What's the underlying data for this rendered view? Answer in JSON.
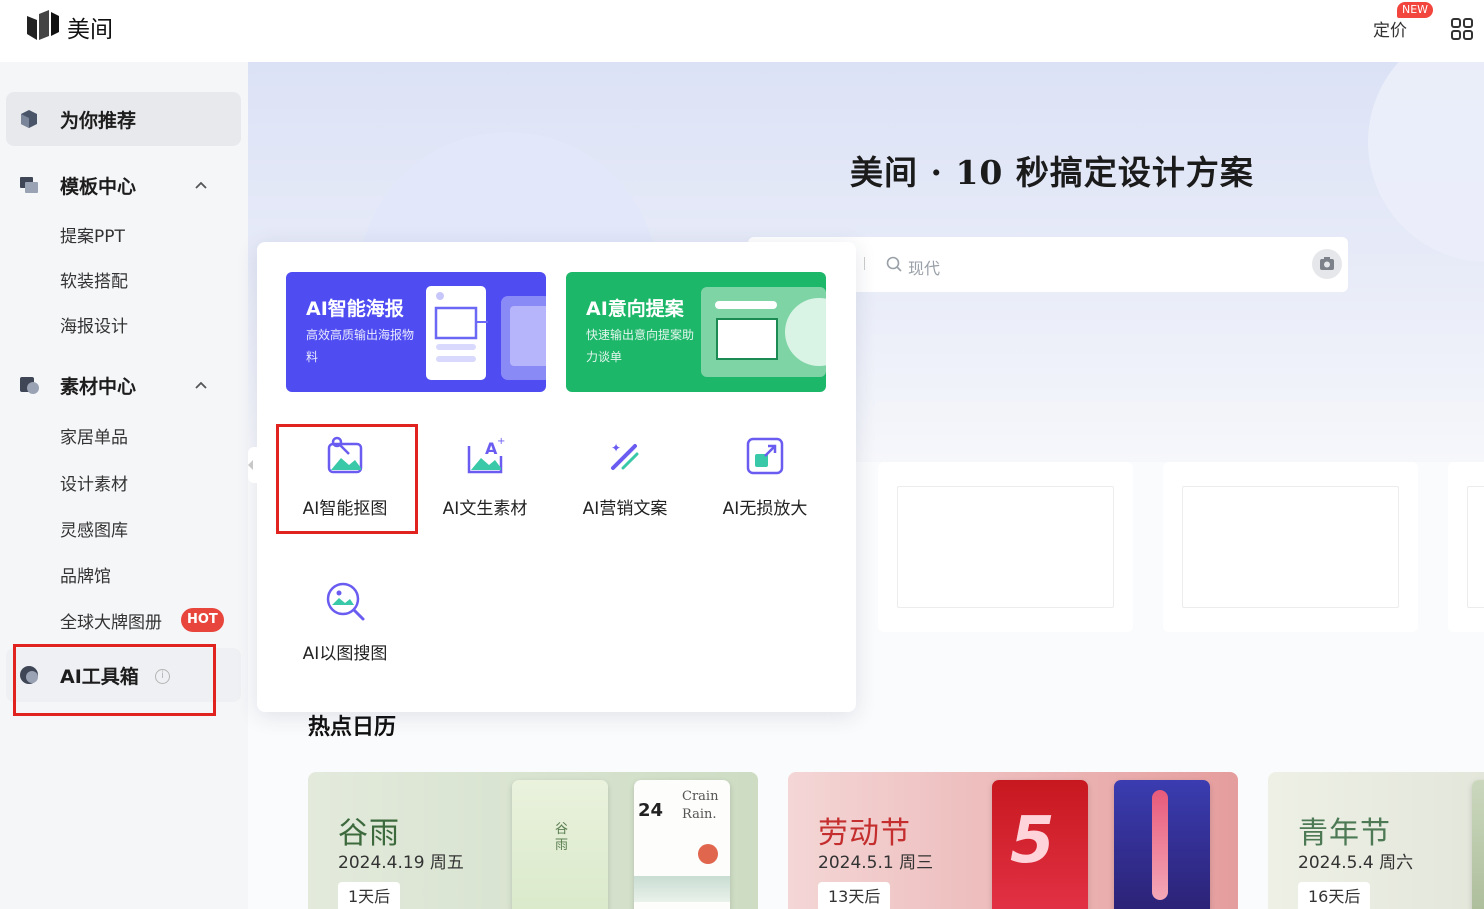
{
  "brand": {
    "name": "美间"
  },
  "header": {
    "pricing_label": "定价",
    "new_badge": "NEW"
  },
  "sidebar": {
    "recommend": "为你推荐",
    "template_center": {
      "label": "模板中心",
      "items": [
        "提案PPT",
        "软装搭配",
        "海报设计"
      ]
    },
    "material_center": {
      "label": "素材中心",
      "items": [
        "家居单品",
        "设计素材",
        "灵感图库",
        "品牌馆",
        "全球大牌图册"
      ],
      "hot_badge": "HOT"
    },
    "ai_toolbox": "AI工具箱"
  },
  "hero": {
    "title": "美间 · 10 秒搞定设计方案",
    "search_placeholder": "现代"
  },
  "ai_popup": {
    "featured": [
      {
        "title": "AI智能海报",
        "desc": "高效高质输出海报物料",
        "color": "#4f4df2"
      },
      {
        "title": "AI意向提案",
        "desc": "快速输出意向提案助力谈单",
        "color": "#1db76a"
      }
    ],
    "tools": [
      "AI智能抠图",
      "AI文生素材",
      "AI营销文案",
      "AI无损放大",
      "AI以图搜图"
    ]
  },
  "calendar": {
    "title": "热点日历",
    "events": [
      {
        "name": "谷雨",
        "date": "2024.4.19 周五",
        "countdown": "1天后",
        "poster_text_1": "Crain Rain.",
        "poster_text_2": "24",
        "poster_text_3": "谷雨"
      },
      {
        "name": "劳动节",
        "date": "2024.5.1  周三",
        "countdown": "13天后",
        "poster_text_1": "5"
      },
      {
        "name": "青年节",
        "date": "2024.5.4 周六",
        "countdown": "16天后"
      }
    ]
  },
  "colors": {
    "accent_red": "#e1231f",
    "hot": "#e8453c",
    "poster_blue": "#4f4df2",
    "proposal_green": "#1db76a"
  }
}
